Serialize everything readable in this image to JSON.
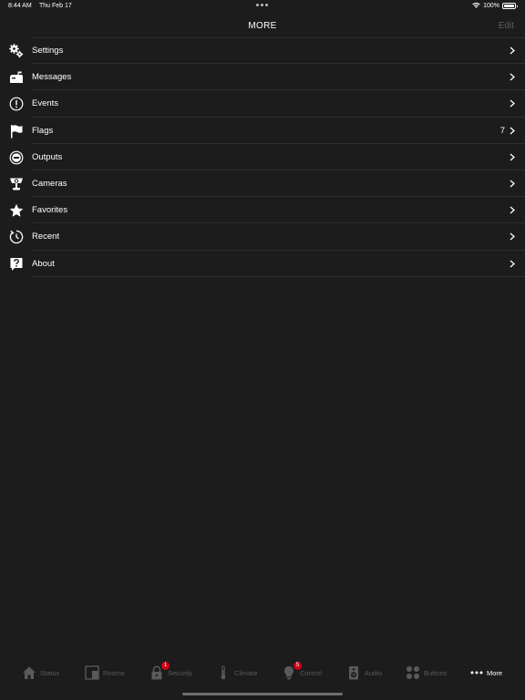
{
  "status_bar": {
    "time": "8:44 AM",
    "date": "Thu Feb 17",
    "battery": "100%"
  },
  "nav": {
    "title": "MORE",
    "edit_label": "Edit"
  },
  "menu": {
    "items": [
      {
        "label": "Settings",
        "icon": "gears-icon",
        "count": ""
      },
      {
        "label": "Messages",
        "icon": "mailbox-icon",
        "count": ""
      },
      {
        "label": "Events",
        "icon": "exclamation-circle-icon",
        "count": ""
      },
      {
        "label": "Flags",
        "icon": "flag-icon",
        "count": "7"
      },
      {
        "label": "Outputs",
        "icon": "output-circle-icon",
        "count": ""
      },
      {
        "label": "Cameras",
        "icon": "camera-icon",
        "count": ""
      },
      {
        "label": "Favorites",
        "icon": "star-icon",
        "count": ""
      },
      {
        "label": "Recent",
        "icon": "clock-icon",
        "count": ""
      },
      {
        "label": "About",
        "icon": "question-icon",
        "count": ""
      }
    ]
  },
  "tabs": [
    {
      "label": "Status",
      "icon": "house-icon",
      "badge": ""
    },
    {
      "label": "Rooms",
      "icon": "rooms-icon",
      "badge": ""
    },
    {
      "label": "Security",
      "icon": "lock-icon",
      "badge": "1"
    },
    {
      "label": "Climate",
      "icon": "thermometer-icon",
      "badge": ""
    },
    {
      "label": "Control",
      "icon": "bulb-icon",
      "badge": "5"
    },
    {
      "label": "Audio",
      "icon": "speaker-icon",
      "badge": ""
    },
    {
      "label": "Buttons",
      "icon": "buttons-grid-icon",
      "badge": ""
    },
    {
      "label": "More",
      "icon": "ellipsis-icon",
      "badge": ""
    }
  ],
  "colors": {
    "background": "#1c1c1c",
    "divider": "#2e2e2e",
    "inactive": "#5a5a5a",
    "active": "#ffffff",
    "badge": "#d0021b"
  }
}
